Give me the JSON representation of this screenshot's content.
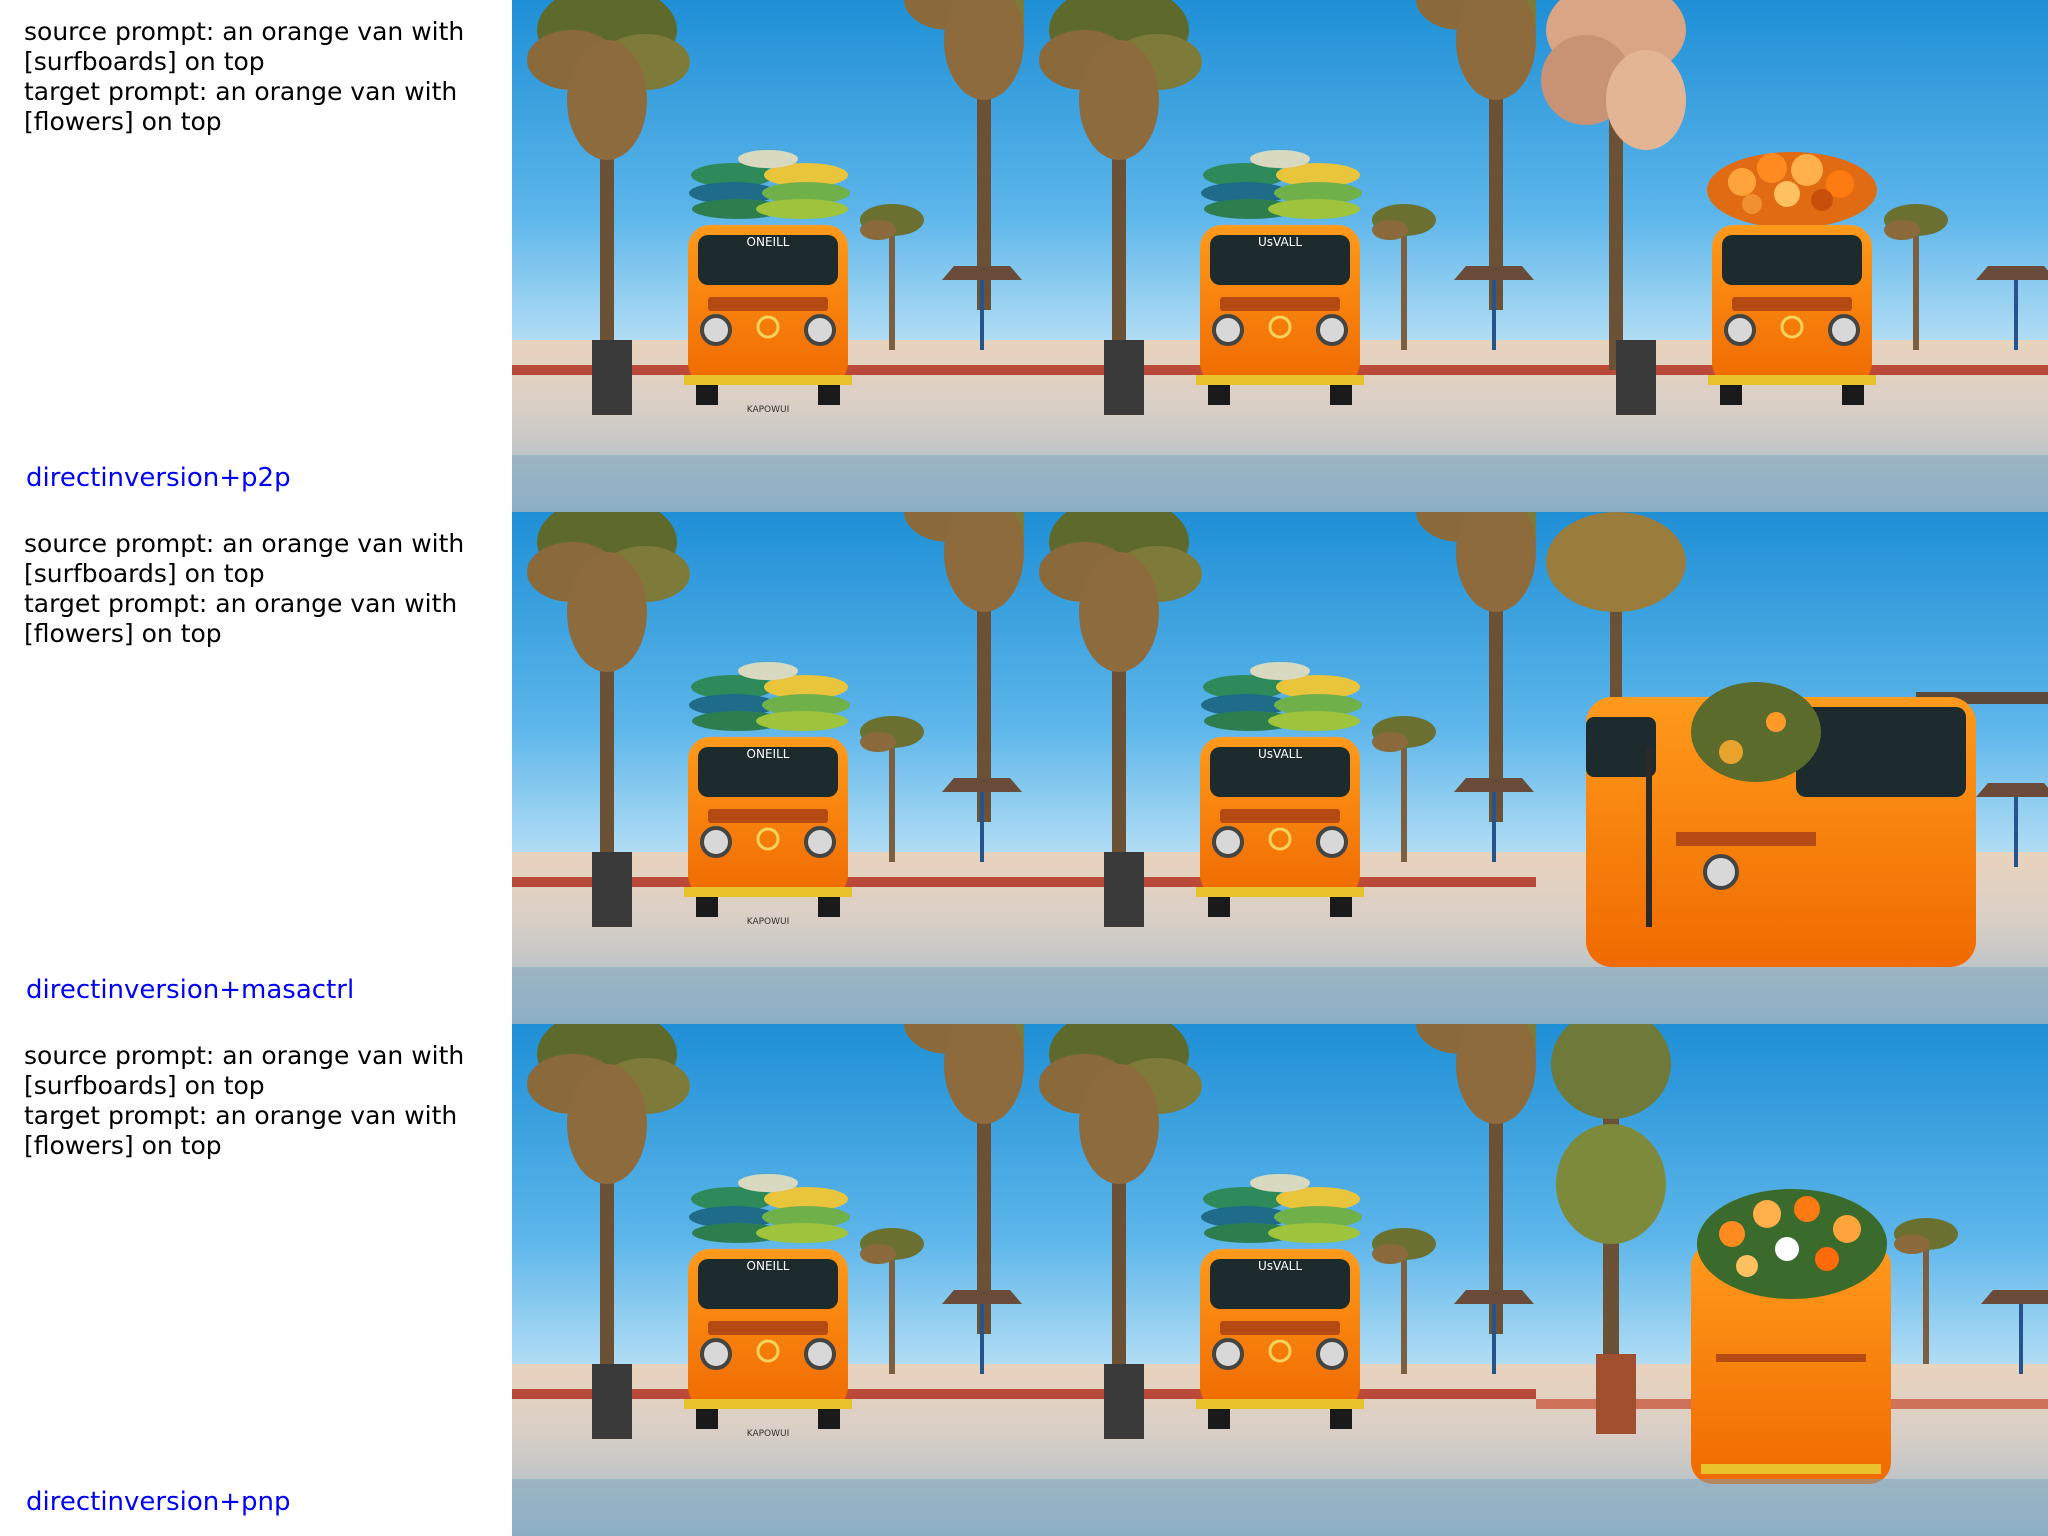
{
  "accent_color": "#0000ff",
  "rows": [
    {
      "source_prompt": "source prompt: an orange van with [surfboards] on top",
      "target_prompt": "target prompt: an orange van with [flowers] on top",
      "method": "directinversion+p2p",
      "images": [
        {
          "content": "van-surfboards-original",
          "grille_text": "ONEILL",
          "plate": "KAPOWUI"
        },
        {
          "content": "van-surfboards-reconstruction",
          "grille_text": "UsVALL",
          "plate": ""
        },
        {
          "content": "van-flowers-edited",
          "grille_text": "",
          "plate": ""
        }
      ]
    },
    {
      "source_prompt": "source prompt: an orange van with [surfboards] on top",
      "target_prompt": "target prompt: an orange van with [flowers] on top",
      "method": "directinversion+masactrl",
      "images": [
        {
          "content": "van-surfboards-original",
          "grille_text": "ONEILL",
          "plate": "KAPOWUI"
        },
        {
          "content": "van-surfboards-reconstruction",
          "grille_text": "UsVALL",
          "plate": ""
        },
        {
          "content": "van-flowers-edited-distorted",
          "grille_text": "",
          "plate": ""
        }
      ]
    },
    {
      "source_prompt": "source prompt: an orange van with [surfboards] on top",
      "target_prompt": "target prompt: an orange van with [flowers] on top",
      "method": "directinversion+pnp",
      "images": [
        {
          "content": "van-surfboards-original",
          "grille_text": "ONEILL",
          "plate": "KAPOWUI"
        },
        {
          "content": "van-surfboards-reconstruction",
          "grille_text": "UsVALL",
          "plate": ""
        },
        {
          "content": "van-flowers-edited-rear",
          "grille_text": "",
          "plate": ""
        }
      ]
    }
  ]
}
